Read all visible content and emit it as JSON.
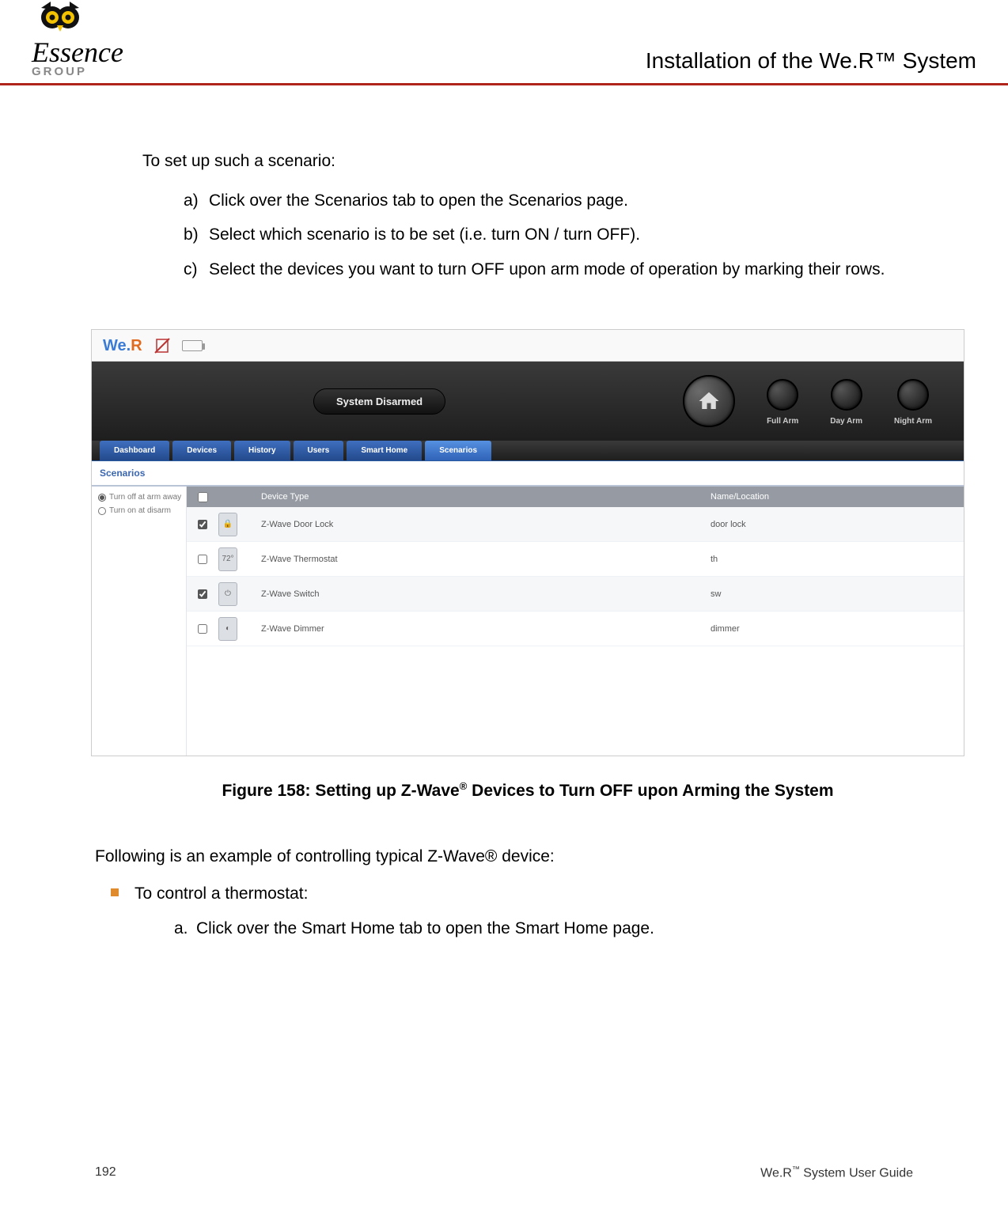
{
  "header": {
    "logo_main": "Essence",
    "logo_sub": "GROUP",
    "page_title": "Installation of the We.R™ System"
  },
  "intro": "To set up such a scenario:",
  "steps": {
    "a_marker": "a)",
    "a": "Click over the Scenarios tab to open the Scenarios page.",
    "b_marker": "b)",
    "b": "Select which scenario is to be set (i.e. turn ON / turn OFF).",
    "c_marker": "c)",
    "c": "Select the devices you want to turn OFF upon arm mode of operation by marking their rows."
  },
  "app": {
    "logo_we": "We.",
    "logo_r": "R",
    "status": "System Disarmed",
    "knobs": {
      "full": "Full Arm",
      "day": "Day Arm",
      "night": "Night Arm"
    },
    "tabs": [
      "Dashboard",
      "Devices",
      "History",
      "Users",
      "Smart Home",
      "Scenarios"
    ],
    "panel_title": "Scenarios",
    "side": {
      "opt1": "Turn off at arm away",
      "opt2": "Turn on at disarm"
    },
    "head": {
      "type": "Device Type",
      "name": "Name/Location"
    },
    "rows": [
      {
        "checked": true,
        "type": "Z-Wave Door Lock",
        "name": "door lock"
      },
      {
        "checked": false,
        "type": "Z-Wave Thermostat",
        "name": "th"
      },
      {
        "checked": true,
        "type": "Z-Wave Switch",
        "name": "sw"
      },
      {
        "checked": false,
        "type": "Z-Wave Dimmer",
        "name": "dimmer"
      }
    ]
  },
  "figure_caption_pre": "Figure 158: Setting up Z-Wave",
  "figure_caption_sup": "®",
  "figure_caption_post": " Devices to Turn OFF upon Arming the System",
  "para2": "Following is an example of controlling typical Z-Wave® device:",
  "bullet1": "To control a thermostat:",
  "sub_a_marker": "a.",
  "sub_a": "Click over the Smart Home tab to open the Smart Home page.",
  "footer": {
    "page": "192",
    "guide_pre": "We.R",
    "guide_sup": "™",
    "guide_post": " System User Guide"
  }
}
